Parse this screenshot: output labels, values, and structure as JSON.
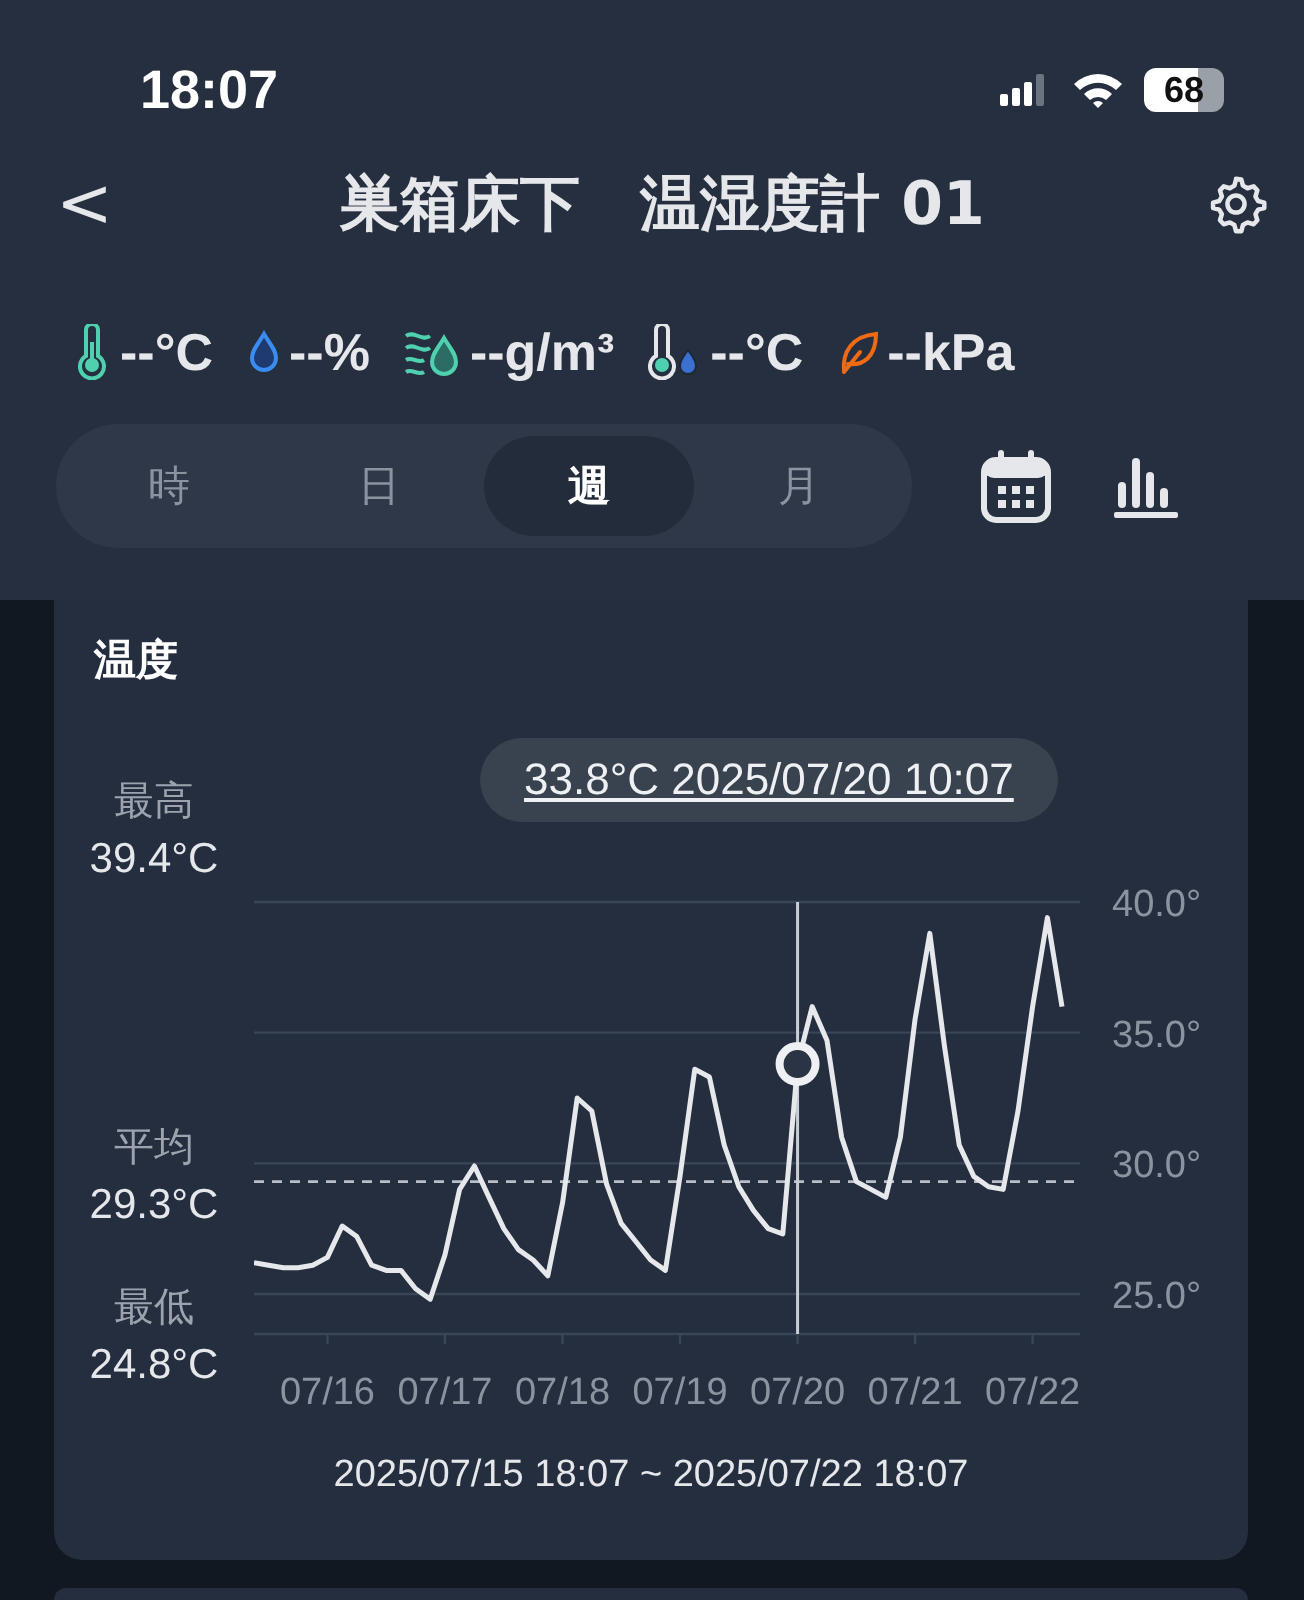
{
  "status_bar": {
    "time": "18:07",
    "battery": "68"
  },
  "header": {
    "back": "<",
    "title": "巣箱床下　温湿度計 01"
  },
  "metrics": [
    {
      "value": "--°C"
    },
    {
      "value": "--%"
    },
    {
      "value": "--g/m³"
    },
    {
      "value": "--°C"
    },
    {
      "value": "--kPa"
    }
  ],
  "period_tabs": [
    {
      "label": "時",
      "selected": false
    },
    {
      "label": "日",
      "selected": false
    },
    {
      "label": "週",
      "selected": true
    },
    {
      "label": "月",
      "selected": false
    }
  ],
  "card": {
    "tooltip": "33.8°C 2025/07/20 10:07",
    "stats": [
      {
        "label": "最高",
        "value": "39.4°C"
      },
      {
        "label": "平均",
        "value": "29.3°C"
      },
      {
        "label": "最低",
        "value": "24.8°C"
      }
    ],
    "chart_data": {
      "type": "line",
      "title": "温度",
      "grid": true,
      "ylim": [
        23.47,
        40
      ],
      "yticks": [
        {
          "value": 25,
          "label": "25.0°"
        },
        {
          "value": 30,
          "label": "30.0°"
        },
        {
          "value": 35,
          "label": "35.0°"
        },
        {
          "value": 40,
          "label": "40.0°"
        }
      ],
      "categories": [
        null,
        null,
        null,
        null,
        null,
        "07/16",
        null,
        null,
        null,
        null,
        null,
        null,
        null,
        "07/17",
        null,
        null,
        null,
        null,
        null,
        null,
        null,
        "07/18",
        null,
        null,
        null,
        null,
        null,
        null,
        null,
        "07/19",
        null,
        null,
        null,
        null,
        null,
        null,
        null,
        "07/20",
        null,
        null,
        null,
        null,
        null,
        null,
        null,
        "07/21",
        null,
        null,
        null,
        null,
        null,
        null,
        null,
        "07/22",
        null,
        null
      ],
      "series": [
        {
          "color": "#e6e8ec",
          "values": [
            26.2,
            26.1,
            26.0,
            26.0,
            26.1,
            26.4,
            27.6,
            27.2,
            26.1,
            25.9,
            25.9,
            25.2,
            24.8,
            26.5,
            29.0,
            29.9,
            28.7,
            27.5,
            26.7,
            26.3,
            25.7,
            28.5,
            32.5,
            32.0,
            29.2,
            27.7,
            27.0,
            26.3,
            25.9,
            29.5,
            33.6,
            33.3,
            30.7,
            29.1,
            28.2,
            27.5,
            27.3,
            33.8,
            36.0,
            34.7,
            31.0,
            29.3,
            29.0,
            28.7,
            31.0,
            35.5,
            38.8,
            34.5,
            30.7,
            29.5,
            29.1,
            29.0,
            32.0,
            36.0,
            39.4,
            36.0
          ]
        }
      ],
      "ref_lines": [
        {
          "axis": "y",
          "value": 29.3
        }
      ],
      "annotations": [
        {
          "x": "07/20"
        }
      ]
    },
    "range": "2025/07/15 18:07 ~ 2025/07/22 18:07"
  }
}
